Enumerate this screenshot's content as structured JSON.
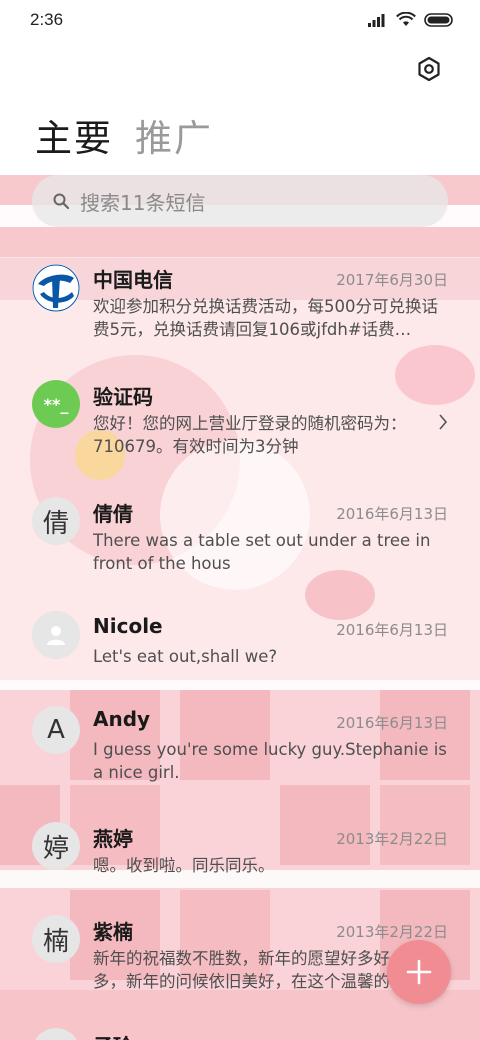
{
  "status_bar": {
    "time": "2:36"
  },
  "tabs": [
    {
      "label": "主要"
    },
    {
      "label": "推广"
    }
  ],
  "search": {
    "placeholder": "搜索11条短信"
  },
  "conversations": [
    {
      "name": "中国电信",
      "date": "2017年6月30日",
      "snippet": "欢迎参加积分兑换话费活动，每500分可兑换话费5元，兑换话费请回复106或jfdh#话费…",
      "avatar_icon": "china-telecom-logo"
    },
    {
      "name": "验证码",
      "date": "",
      "snippet": "您好！您的网上营业厅登录的随机密码为：710679。有效时间为3分钟",
      "avatar_text": "**_",
      "avatar_color": "#6dcb53"
    },
    {
      "name": "倩倩",
      "date": "2016年6月13日",
      "snippet": "There was a table set out under a tree in front of the hous",
      "avatar_text": "倩"
    },
    {
      "name": "Nicole",
      "date": "2016年6月13日",
      "snippet": "Let's eat out,shall we?",
      "avatar_icon": "person-icon"
    },
    {
      "name": "Andy",
      "date": "2016年6月13日",
      "snippet": "I guess you're some lucky guy.Stephanie is a nice girl.",
      "avatar_text": "A"
    },
    {
      "name": "燕婷",
      "date": "2013年2月22日",
      "snippet": "嗯。收到啦。同乐同乐。",
      "avatar_text": "婷"
    },
    {
      "name": "紫楠",
      "date": "2013年2月22日",
      "snippet": "新年的祝福数不胜数，新年的愿望好多好多，新年的问候依旧美好，在这个温馨的时刻…",
      "avatar_text": "楠"
    },
    {
      "name": "子玲",
      "date": "",
      "snippet": "",
      "avatar_text": ""
    }
  ],
  "colors": {
    "accent": "#f08c92",
    "verify_green": "#6dcb53",
    "telecom_blue": "#0a57a6"
  }
}
